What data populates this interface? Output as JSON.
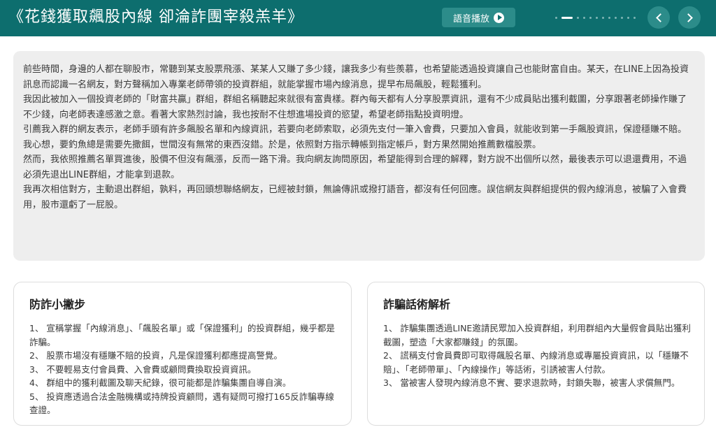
{
  "header": {
    "title": "《花錢獲取飆股內線 卻淪詐團宰殺羔羊》",
    "audio_label": "語音播放",
    "pagination_count": 12,
    "pagination_active": 1
  },
  "story": {
    "paragraphs": [
      "前些時間，身邊的人都在聊股市，常聽到某支股票飛漲、某某人又賺了多少錢，讓我多少有些羨慕，也希望能透過投資讓自己也能財富自由。某天，在LINE上因為投資訊息而認識一名網友，對方聲稱加入專業老師帶領的投資群組，就能掌握市場內線消息，提早布局飆股，輕鬆獲利。",
      "我因此被加入一個投資老師的「財富共贏」群組，群組名稱聽起來就很有富貴樣。群內每天都有人分享股票資訊，還有不少成員貼出獲利截圖，分享跟著老師操作賺了不少錢，向老師表達感激之意。看著大家熱烈討論，我也按耐不住想進場投資的慾望，希望老師指點投資明燈。",
      "引薦我入群的網友表示，老師手頭有許多飆股名單和內線資訊，若要向老師索取，必須先支付一筆入會費，只要加入會員，就能收到第一手飆股資訊，保證穩賺不賠。",
      "我心想，要釣魚總是需要先撒餌，世間沒有無常的東西沒錯。於是，依照對方指示轉帳到指定帳戶，對方果然開始推薦數檔股票。",
      "然而，我依照推薦名單買進後，股價不但沒有飆漲，反而一路下滑。我向網友詢問原因，希望能得到合理的解釋，對方說不出個所以然，最後表示可以退還費用，不過必須先退出LINE群組，才能拿到退款。",
      "我再次相信對方，主動退出群組，孰料，再回頭想聯絡網友，已經被封鎖，無論傳訊或撥打語音，都沒有任何回應。誤信網友與群組提供的假內線消息，被騙了入會費用，股市還虧了一屁股。"
    ]
  },
  "tips": {
    "title": "防詐小撇步",
    "items": [
      "1、 宣稱掌握「內線消息」、「飆股名單」或「保證獲利」的投資群組，幾乎都是詐騙。",
      "2、 股票市場沒有穩賺不賠的投資，凡是保證獲利都應提高警覺。",
      "3、 不要輕易支付會員費、入會費或顧問費換取投資資訊。",
      "4、 群組中的獲利截圖及聊天紀錄，很可能都是詐騙集團自導自演。",
      "5、 投資應透過合法金融機構或持牌投資顧問，遇有疑問可撥打165反詐騙專線查證。"
    ]
  },
  "analysis": {
    "title": "詐騙話術解析",
    "items": [
      "1、 詐騙集團透過LINE邀請民眾加入投資群組，利用群組內大量假會員貼出獲利截圖，塑造「大家都賺錢」的氛圍。",
      "2、 謊稱支付會員費即可取得飆股名單、內線消息或專屬投資資訊，以「穩賺不賠」、「老師帶單」、「內線操作」等話術，引誘被害人付款。",
      "3、 當被害人發現內線消息不實、要求退款時，封鎖失聯，被害人求償無門。"
    ]
  },
  "colors": {
    "header_bg": "#0d6e6e",
    "button_bg": "#2c8c8a",
    "story_bg": "#eeeeee"
  },
  "icons": {
    "audio": "play-circle-icon",
    "prev": "chevron-left-icon",
    "next": "chevron-right-icon"
  }
}
